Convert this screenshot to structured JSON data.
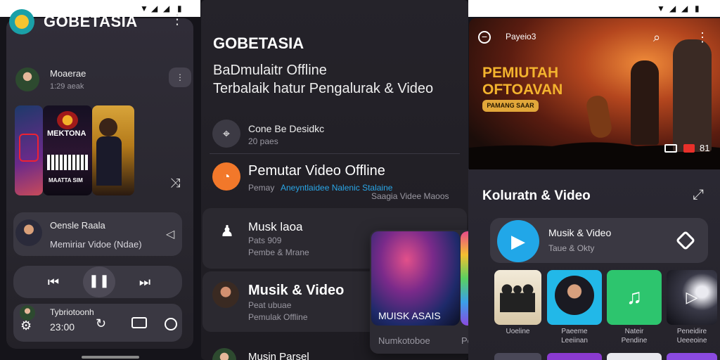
{
  "left": {
    "status_icons": [
      "wifi-icon",
      "signal-icon",
      "signal-icon",
      "battery-icon"
    ],
    "app_title": "GOBETASIA",
    "menu_icon": "kebab-icon",
    "now_row": {
      "title": "Moaerae",
      "sub": "1:29 aeak",
      "more": "⋮"
    },
    "album_art": {
      "title": "MEKTONA",
      "subtitle": "MAATTA SIM"
    },
    "track": {
      "title": "Oensle Raala",
      "sub": "Memiriar Vidoe (Ndae)"
    },
    "bottom_row": {
      "title": "Tybriotoonh",
      "sub": "23:00"
    },
    "colors": {
      "accent_orange": "#f2782a",
      "accent_blue": "#21a7e8"
    }
  },
  "middle": {
    "app_title": "GOBETASIA",
    "heading_line1": "BaDmulaitr Offline",
    "heading_line2": "Terbalaik hatur Pengalurak & Video",
    "rows": [
      {
        "title": "Cone Be Desidkc",
        "sub": "20 paes"
      },
      {
        "title": "Pemutar Video Offline",
        "sub_a": "Pemay",
        "sub_b": "Aneyntlaidee Nalenic Stalaine",
        "sub_c": "Saagia Videe Maoos"
      },
      {
        "title": "Musk laoa",
        "sub1": "Pats 909",
        "sub2": "Pembe & Mrane"
      },
      {
        "title": "Musik & Video",
        "sub1": "Peat ubuae",
        "sub2": "Pemulak Offline"
      },
      {
        "title": "Musin Parsel"
      }
    ],
    "popup": {
      "art_label": "MUISK ASAIS",
      "footer_left": "Numkotoboe",
      "footer_right": "Peale"
    }
  },
  "right": {
    "status_icons": [
      "wifi-icon",
      "signal-icon",
      "signal-icon",
      "battery-icon"
    ],
    "hero": {
      "top_label": "Payeio3",
      "title_line1": "PEMIUTAH",
      "title_line2": "OFTOAVAN",
      "badge": "PAMANG SAAR",
      "counter": "81"
    },
    "section_title": "Koluratn & Video",
    "player": {
      "title": "Musik & Video",
      "sub": "Taue & Okty"
    },
    "tiles": [
      {
        "line1": "Uoeline",
        "line2": ""
      },
      {
        "line1": "Paeeme",
        "line2": "Leeiinan"
      },
      {
        "line1": "Nateir",
        "line2": "Pendine"
      },
      {
        "line1": "Peneidire",
        "line2": "Ueeeoine"
      }
    ]
  }
}
